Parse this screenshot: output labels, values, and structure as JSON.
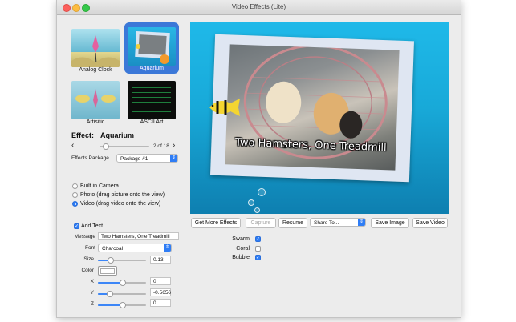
{
  "window": {
    "title": "Video Effects (Lite)"
  },
  "effects_grid": [
    {
      "label": "Analog Clock",
      "selected": false
    },
    {
      "label": "Aquarium",
      "selected": true
    },
    {
      "label": "Artisitic",
      "selected": false
    },
    {
      "label": "ASCII Art",
      "selected": false
    }
  ],
  "effect": {
    "label": "Effect:",
    "name": "Aquarium",
    "page": "2 of 18",
    "prev": "‹",
    "next": "›"
  },
  "package": {
    "label": "Effects Package",
    "value": "Package #1"
  },
  "source": {
    "options": [
      "Built in Camera",
      "Photo (drag picture onto the view)",
      "Video (drag video onto the view)"
    ],
    "selected_index": 2
  },
  "text_settings": {
    "add_text_label": "Add Text...",
    "add_text_checked": true,
    "message_label": "Message",
    "message_value": "Two Hamsters, One Treadmill",
    "font_label": "Font",
    "font_value": "Charcoal",
    "size_label": "Size",
    "size_value": "0.13",
    "color_label": "Color",
    "x_label": "X",
    "x_value": "0",
    "y_label": "Y",
    "y_value": "-0.5656",
    "z_label": "Z",
    "z_value": "0"
  },
  "preview": {
    "caption": "Two Hamsters, One Treadmill"
  },
  "toolbar": {
    "get_more": "Get More Effects",
    "capture": "Capture",
    "resume": "Resume",
    "share": "Share To...",
    "save_image": "Save Image",
    "save_video": "Save Video"
  },
  "options": [
    {
      "label": "Swarm",
      "checked": true
    },
    {
      "label": "Coral",
      "checked": false
    },
    {
      "label": "Bubble",
      "checked": true
    }
  ],
  "colors": {
    "accent": "#2f7df5",
    "preview_bg": "#18a9d8"
  }
}
